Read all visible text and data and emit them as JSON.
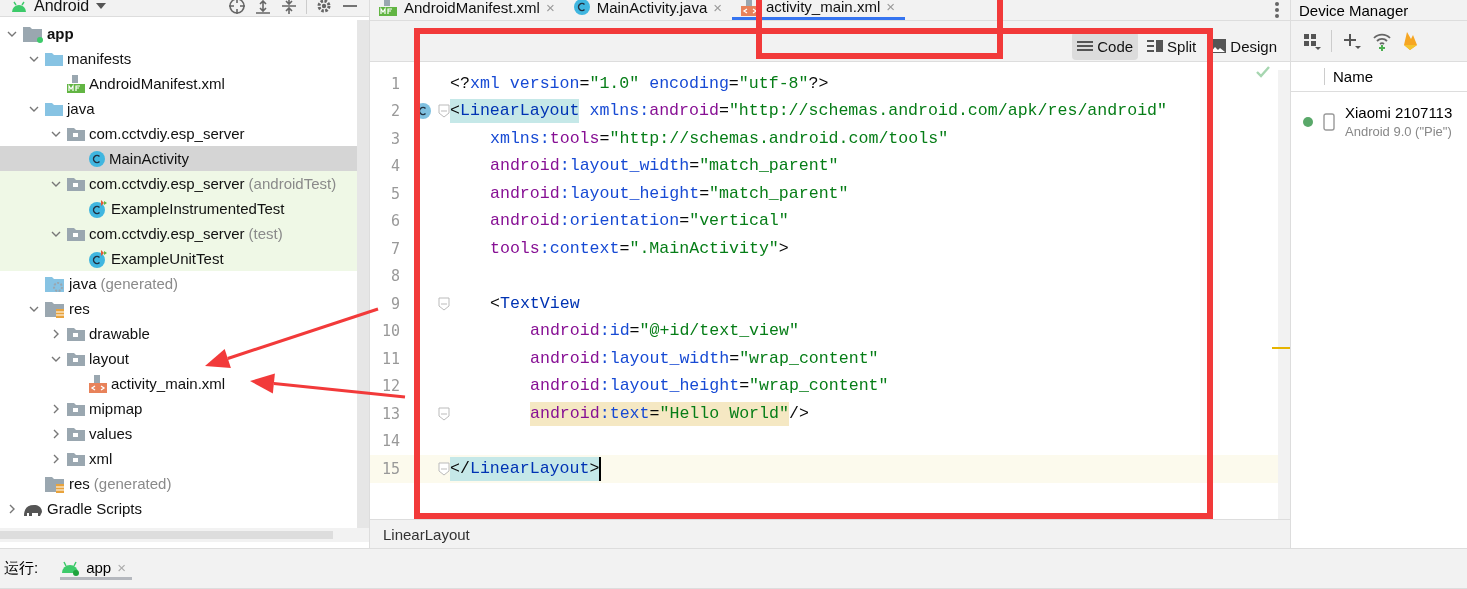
{
  "project_panel": {
    "view_selector": "Android",
    "tree": [
      {
        "label": "app",
        "kind": "module",
        "bold": true,
        "expanded": true,
        "selected": false,
        "children": [
          {
            "label": "manifests",
            "kind": "folder",
            "expanded": true,
            "selected": false,
            "children": [
              {
                "label": "AndroidManifest.xml",
                "kind": "manifest",
                "selected": false
              }
            ]
          },
          {
            "label": "java",
            "kind": "folder",
            "expanded": true,
            "selected": false,
            "children": [
              {
                "label": "com.cctvdiy.esp_server",
                "kind": "package",
                "expanded": true,
                "selected": false,
                "children": [
                  {
                    "label": "MainActivity",
                    "kind": "class",
                    "selected": true
                  }
                ]
              },
              {
                "label": "com.cctvdiy.esp_server",
                "suffix": "(androidTest)",
                "kind": "package",
                "test": true,
                "expanded": true,
                "selected": false,
                "children": [
                  {
                    "label": "ExampleInstrumentedTest",
                    "kind": "test-class",
                    "selected": false
                  }
                ]
              },
              {
                "label": "com.cctvdiy.esp_server",
                "suffix": "(test)",
                "kind": "package",
                "test": true,
                "expanded": true,
                "selected": false,
                "children": [
                  {
                    "label": "ExampleUnitTest",
                    "kind": "test-class",
                    "selected": false
                  }
                ]
              }
            ]
          },
          {
            "label": "java",
            "suffix": "(generated)",
            "kind": "generated-folder",
            "selected": false
          },
          {
            "label": "res",
            "kind": "res-folder",
            "expanded": true,
            "selected": false,
            "children": [
              {
                "label": "drawable",
                "kind": "package",
                "expanded": false,
                "selected": false
              },
              {
                "label": "layout",
                "kind": "package",
                "expanded": true,
                "selected": false,
                "children": [
                  {
                    "label": "activity_main.xml",
                    "kind": "layout-file",
                    "selected": false
                  }
                ]
              },
              {
                "label": "mipmap",
                "kind": "package",
                "expanded": false,
                "selected": false
              },
              {
                "label": "values",
                "kind": "package",
                "expanded": false,
                "selected": false
              },
              {
                "label": "xml",
                "kind": "package",
                "expanded": false,
                "selected": false
              }
            ]
          },
          {
            "label": "res",
            "suffix": "(generated)",
            "kind": "res-folder",
            "selected": false
          }
        ]
      },
      {
        "label": "Gradle Scripts",
        "kind": "gradle",
        "expanded": false,
        "selected": false
      }
    ]
  },
  "editor": {
    "tabs": [
      {
        "label": "AndroidManifest.xml",
        "kind": "manifest",
        "close": "×",
        "selected": false
      },
      {
        "label": "MainActivity.java",
        "kind": "class",
        "close": "×",
        "selected": false
      },
      {
        "label": "activity_main.xml",
        "kind": "layout-file",
        "close": "×",
        "selected": true
      }
    ],
    "view_modes": [
      {
        "label": "Code",
        "kind": "code",
        "selected": true
      },
      {
        "label": "Split",
        "kind": "split",
        "selected": false
      },
      {
        "label": "Design",
        "kind": "design",
        "selected": false
      }
    ],
    "lines": [
      {
        "number": "1",
        "current": false,
        "tokens": [
          {
            "kind": "punct",
            "text": "<?"
          },
          {
            "kind": "attr",
            "text": "xml version"
          },
          {
            "kind": "punct",
            "text": "="
          },
          {
            "kind": "value",
            "text": "\"1.0\""
          },
          {
            "kind": "attr",
            "text": " encoding"
          },
          {
            "kind": "punct",
            "text": "="
          },
          {
            "kind": "value",
            "text": "\"utf-8\""
          },
          {
            "kind": "punct",
            "text": "?>"
          }
        ]
      },
      {
        "number": "2",
        "current": false,
        "tokens": [
          {
            "kind": "punct-match",
            "text": "<"
          },
          {
            "kind": "tag-match",
            "text": "LinearLayout"
          },
          {
            "kind": "attr",
            "text": " xmlns:"
          },
          {
            "kind": "ns",
            "text": "android"
          },
          {
            "kind": "punct",
            "text": "="
          },
          {
            "kind": "value",
            "text": "\"http://schemas.android.com/apk/res/android\""
          }
        ],
        "children": [
          {
            "number": "3",
            "current": false,
            "tokens": [
              {
                "kind": "attr",
                "text": "xmlns:"
              },
              {
                "kind": "ns",
                "text": "tools"
              },
              {
                "kind": "punct",
                "text": "="
              },
              {
                "kind": "value",
                "text": "\"http://schemas.android.com/tools\""
              }
            ]
          },
          {
            "number": "4",
            "current": false,
            "tokens": [
              {
                "kind": "ns",
                "text": "android"
              },
              {
                "kind": "attr",
                "text": ":layout_width"
              },
              {
                "kind": "punct",
                "text": "="
              },
              {
                "kind": "value",
                "text": "\"match_parent\""
              }
            ]
          },
          {
            "number": "5",
            "current": false,
            "tokens": [
              {
                "kind": "ns",
                "text": "android"
              },
              {
                "kind": "attr",
                "text": ":layout_height"
              },
              {
                "kind": "punct",
                "text": "="
              },
              {
                "kind": "value",
                "text": "\"match_parent\""
              }
            ]
          },
          {
            "number": "6",
            "current": false,
            "tokens": [
              {
                "kind": "ns",
                "text": "android"
              },
              {
                "kind": "attr",
                "text": ":orientation"
              },
              {
                "kind": "punct",
                "text": "="
              },
              {
                "kind": "value",
                "text": "\"vertical\""
              }
            ]
          },
          {
            "number": "7",
            "current": false,
            "tokens": [
              {
                "kind": "ns",
                "text": "tools"
              },
              {
                "kind": "attr",
                "text": ":context"
              },
              {
                "kind": "punct",
                "text": "="
              },
              {
                "kind": "value",
                "text": "\".MainActivity\""
              },
              {
                "kind": "punct",
                "text": ">"
              }
            ]
          },
          {
            "number": "8",
            "current": false
          },
          {
            "number": "9",
            "current": false,
            "tokens": [
              {
                "kind": "punct",
                "text": "<"
              },
              {
                "kind": "tag",
                "text": "TextView"
              }
            ],
            "children": [
              {
                "number": "10",
                "current": false,
                "tokens": [
                  {
                    "kind": "ns",
                    "text": "android"
                  },
                  {
                    "kind": "attr",
                    "text": ":id"
                  },
                  {
                    "kind": "punct",
                    "text": "="
                  },
                  {
                    "kind": "value",
                    "text": "\"@+id/text_view\""
                  }
                ]
              },
              {
                "number": "11",
                "current": false,
                "tokens": [
                  {
                    "kind": "ns",
                    "text": "android"
                  },
                  {
                    "kind": "attr",
                    "text": ":layout_width"
                  },
                  {
                    "kind": "punct",
                    "text": "="
                  },
                  {
                    "kind": "value",
                    "text": "\"wrap_content\""
                  }
                ]
              },
              {
                "number": "12",
                "current": false,
                "tokens": [
                  {
                    "kind": "ns",
                    "text": "android"
                  },
                  {
                    "kind": "attr",
                    "text": ":layout_height"
                  },
                  {
                    "kind": "punct",
                    "text": "="
                  },
                  {
                    "kind": "value",
                    "text": "\"wrap_content\""
                  }
                ]
              },
              {
                "number": "13",
                "current": false,
                "tokens": [
                  {
                    "kind": "ns-warn",
                    "text": "android"
                  },
                  {
                    "kind": "attr-warn",
                    "text": ":text"
                  },
                  {
                    "kind": "punct-warn",
                    "text": "="
                  },
                  {
                    "kind": "value-warn",
                    "text": "\"Hello World\""
                  },
                  {
                    "kind": "punct",
                    "text": "/>"
                  }
                ]
              }
            ]
          },
          {
            "number": "14",
            "current": false
          }
        ]
      },
      {
        "number": "15",
        "current": true,
        "tokens": [
          {
            "kind": "punct-match",
            "text": "</"
          },
          {
            "kind": "tag-match",
            "text": "LinearLayout"
          },
          {
            "kind": "punct-match",
            "text": ">"
          }
        ]
      }
    ],
    "breadcrumb": "LinearLayout"
  },
  "device_manager": {
    "title": "Device Manager",
    "column": "Name",
    "devices": [
      {
        "name": "Xiaomi 2107113",
        "detail": "Android 9.0 (\"Pie\")",
        "color": "#59a869"
      }
    ]
  },
  "run_bar": {
    "label": "运行:",
    "tabs": [
      {
        "label": "app",
        "close": "×",
        "selected": true
      }
    ]
  },
  "annotations": [
    {
      "kind": "frame"
    },
    {
      "kind": "frame"
    },
    {
      "kind": "arrow"
    },
    {
      "kind": "arrow"
    }
  ]
}
